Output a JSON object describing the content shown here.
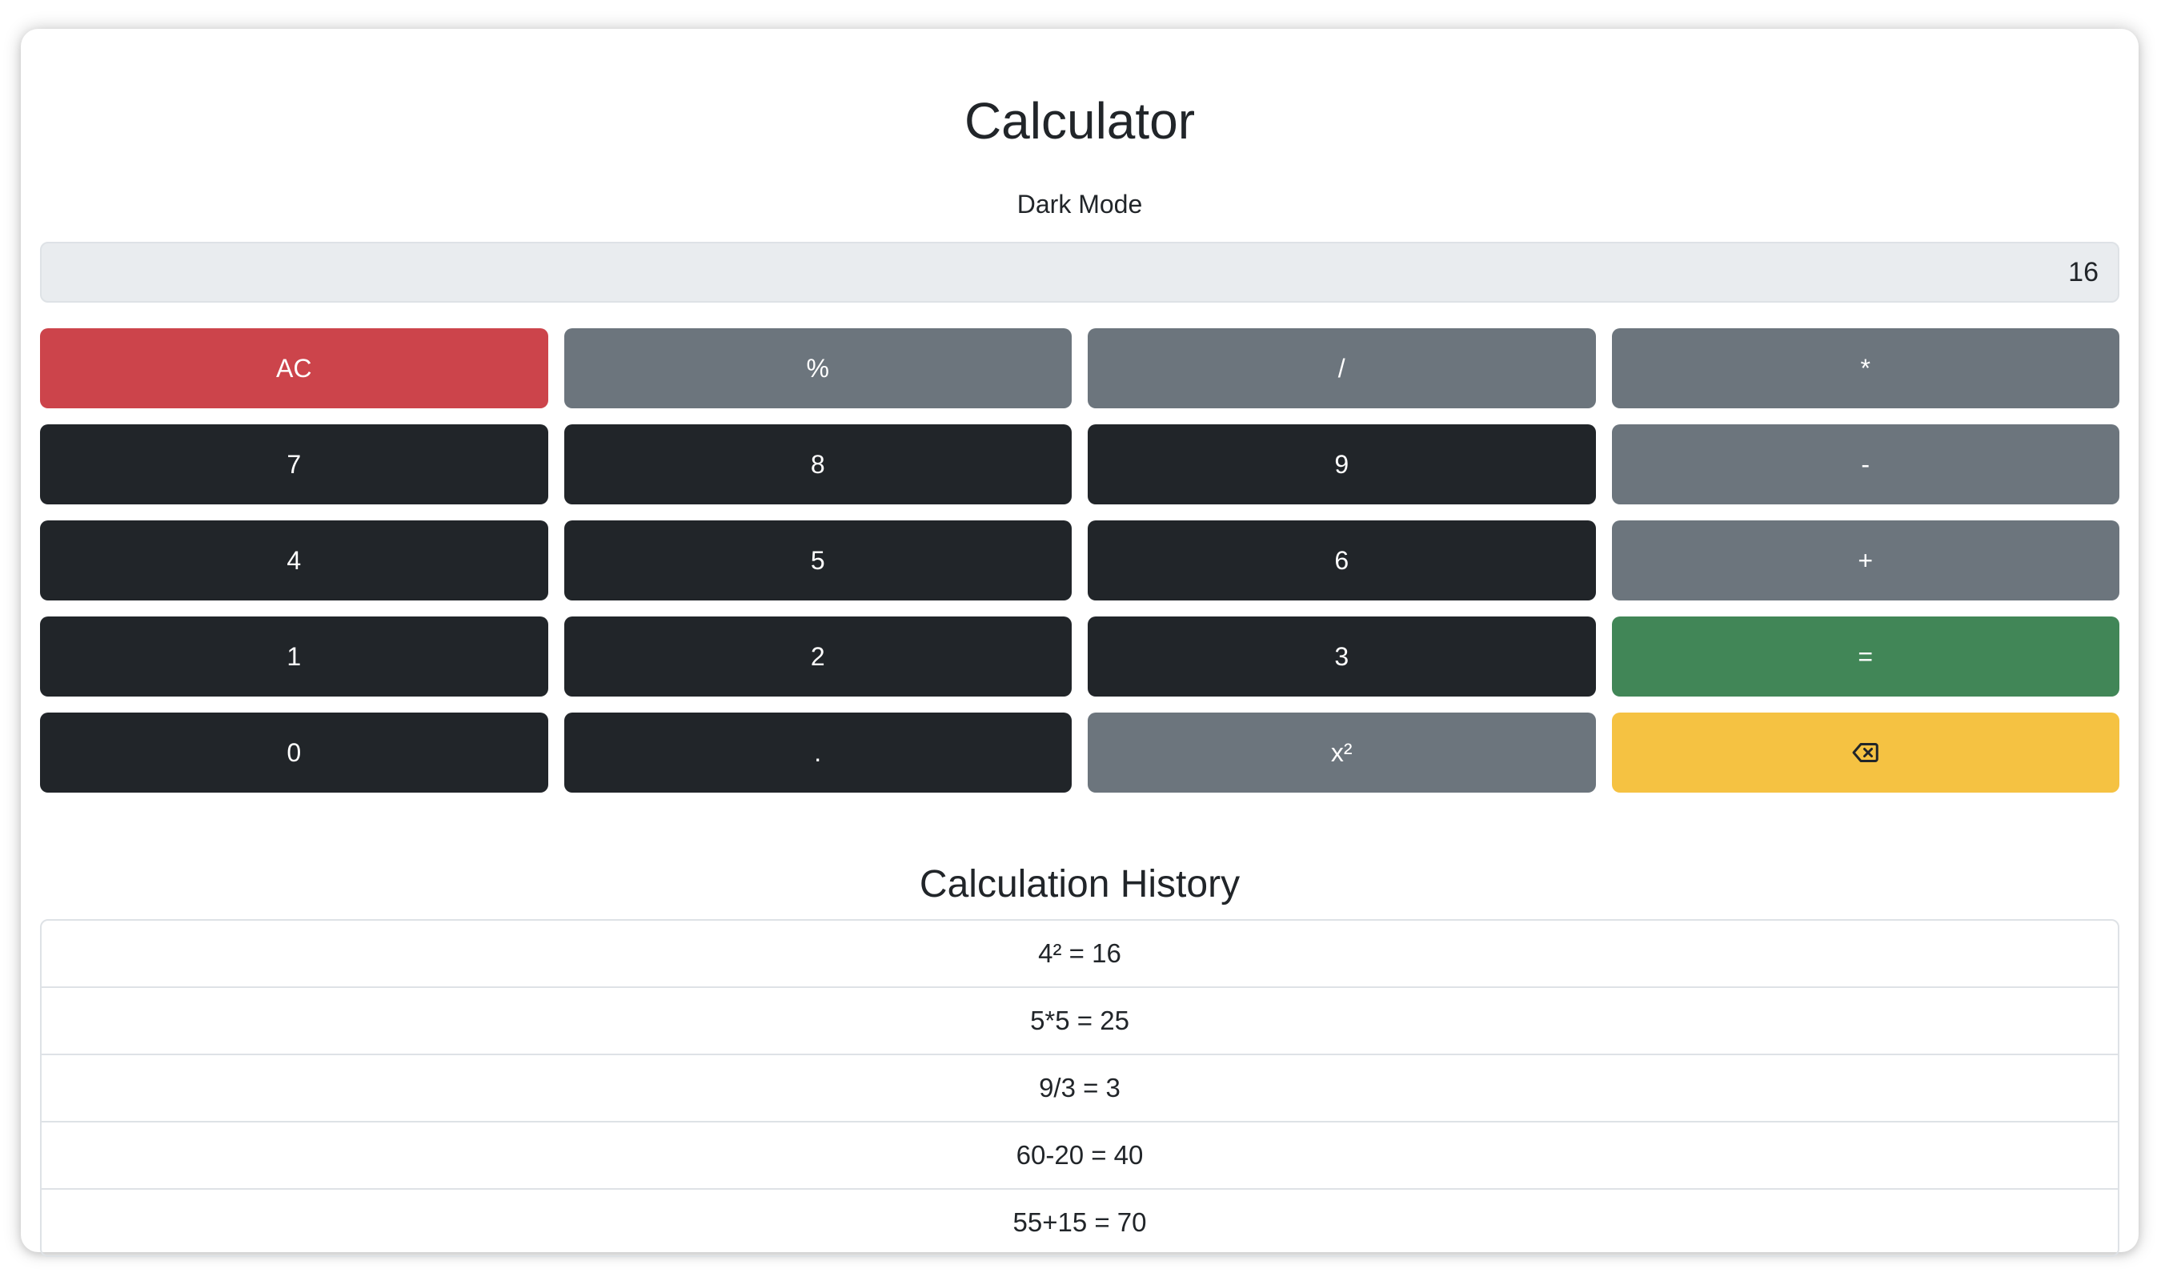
{
  "app": {
    "title": "Calculator",
    "mode_toggle_label": "Dark Mode"
  },
  "display": {
    "value": "16"
  },
  "keypad": {
    "keys": [
      {
        "label": "AC",
        "name": "clear-button",
        "style": "red"
      },
      {
        "label": "%",
        "name": "percent-button",
        "style": "gray"
      },
      {
        "label": "/",
        "name": "divide-button",
        "style": "gray"
      },
      {
        "label": "*",
        "name": "multiply-button",
        "style": "gray"
      },
      {
        "label": "7",
        "name": "digit-7-button",
        "style": "dark"
      },
      {
        "label": "8",
        "name": "digit-8-button",
        "style": "dark"
      },
      {
        "label": "9",
        "name": "digit-9-button",
        "style": "dark"
      },
      {
        "label": "-",
        "name": "subtract-button",
        "style": "gray"
      },
      {
        "label": "4",
        "name": "digit-4-button",
        "style": "dark"
      },
      {
        "label": "5",
        "name": "digit-5-button",
        "style": "dark"
      },
      {
        "label": "6",
        "name": "digit-6-button",
        "style": "dark"
      },
      {
        "label": "+",
        "name": "add-button",
        "style": "gray"
      },
      {
        "label": "1",
        "name": "digit-1-button",
        "style": "dark"
      },
      {
        "label": "2",
        "name": "digit-2-button",
        "style": "dark"
      },
      {
        "label": "3",
        "name": "digit-3-button",
        "style": "dark"
      },
      {
        "label": "=",
        "name": "equals-button",
        "style": "green"
      },
      {
        "label": "0",
        "name": "digit-0-button",
        "style": "dark"
      },
      {
        "label": ".",
        "name": "decimal-button",
        "style": "dark"
      },
      {
        "label": "x²",
        "name": "square-button",
        "style": "gray"
      },
      {
        "label": "",
        "name": "backspace-button",
        "style": "yellow",
        "icon": "backspace-icon"
      }
    ]
  },
  "history": {
    "title": "Calculation History",
    "items": [
      "4² = 16",
      "5*5 = 25",
      "9/3 = 3",
      "60-20 = 40",
      "55+15 = 70"
    ]
  },
  "colors": {
    "red": "#cc444b",
    "gray": "#6c757d",
    "dark": "#212529",
    "green": "#418657",
    "yellow": "#f5c242"
  }
}
